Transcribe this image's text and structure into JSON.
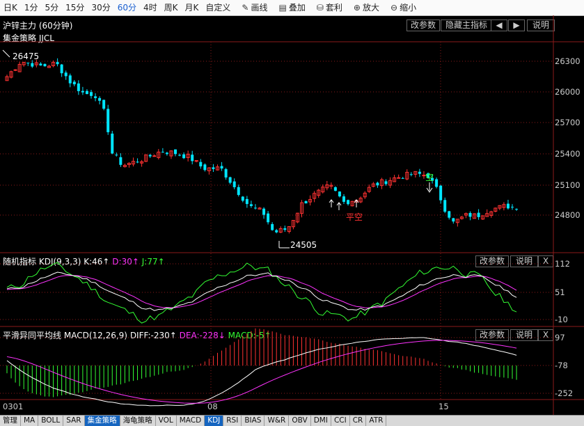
{
  "toolbar": {
    "periods": [
      "日K",
      "1分",
      "5分",
      "15分",
      "30分",
      "60分",
      "4时",
      "周K",
      "月K",
      "自定义"
    ],
    "active_period": "60分",
    "tools": [
      {
        "label": "画线",
        "icon": "pencil-icon"
      },
      {
        "label": "叠加",
        "icon": "layers-icon"
      },
      {
        "label": "套利",
        "icon": "moneybag-icon"
      },
      {
        "label": "放大",
        "icon": "zoom-in-icon"
      },
      {
        "label": "缩小",
        "icon": "zoom-out-icon"
      }
    ]
  },
  "main": {
    "title": "沪锌主力 (60分钟)",
    "subtitle": "集金策略 JJCL",
    "buttons": [
      "改参数",
      "隐藏主指标",
      "◀",
      "▶",
      "说明"
    ],
    "high_label": "26475",
    "low_label": "24505",
    "signal_kong": "空",
    "signal_pingkong": "平空",
    "axis": [
      "26300",
      "26000",
      "25700",
      "25400",
      "25100",
      "24800"
    ]
  },
  "kdj": {
    "title": "随机指标",
    "params": "KDJ(9,3,3)",
    "k": "K:46↑",
    "d": "D:30↑",
    "j": "J:77↑",
    "buttons": [
      "改参数",
      "说明",
      "X"
    ],
    "axis": [
      "112",
      "51",
      "-10"
    ]
  },
  "macd": {
    "title": "平滑异同平均线",
    "params": "MACD(12,26,9)",
    "diff": "DIFF:-230↑",
    "dea": "DEA:-228↓",
    "macd": "MACD:-5↑",
    "buttons": [
      "改参数",
      "说明",
      "X"
    ],
    "axis": [
      "97",
      "-78",
      "-252"
    ]
  },
  "dates": [
    "0301",
    "08",
    "15"
  ],
  "bottom_tabs": [
    "管理",
    "MA",
    "BOLL",
    "SAR",
    "集金策略",
    "海龟策略",
    "VOL",
    "MACD",
    "KDJ",
    "RSI",
    "BIAS",
    "W&R",
    "OBV",
    "DMI",
    "CCI",
    "CR",
    "ATR"
  ],
  "active_tab": "KDJ",
  "highlight_tab": "集金策略",
  "colors": {
    "up": "#ff3232",
    "down": "#00e5ff",
    "k": "#ffffff",
    "d": "#ff33ff",
    "j": "#33ff33",
    "grid": "#8b1a1a"
  }
}
